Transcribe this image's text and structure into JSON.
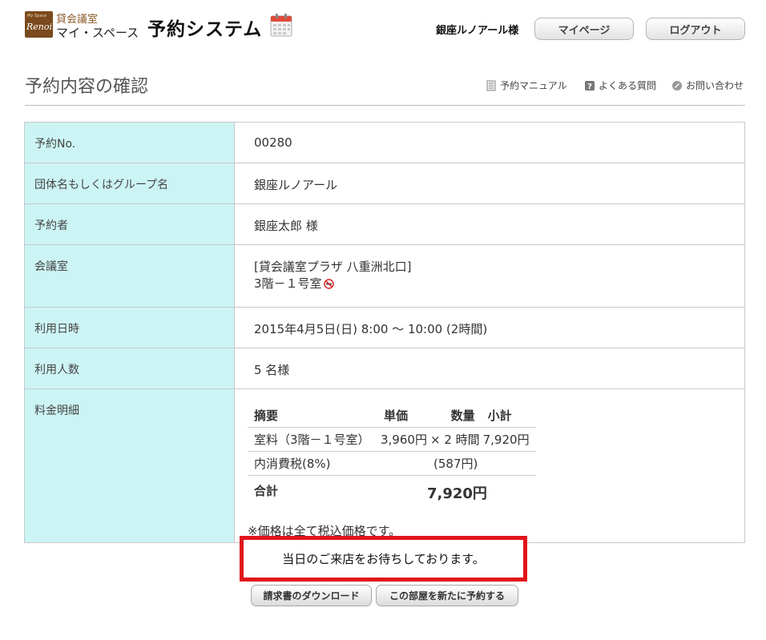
{
  "header": {
    "logo_text": "Renoir",
    "logo_top_text": "My Space",
    "brand_sub": "貸会議室",
    "brand_name": "マイ・スペース",
    "system_title": "予約システム",
    "user_name": "銀座ルノアール様",
    "mypage_label": "マイページ",
    "logout_label": "ログアウト"
  },
  "page": {
    "title": "予約内容の確認",
    "links": {
      "manual": "予約マニュアル",
      "faq": "よくある質問",
      "contact": "お問い合わせ"
    }
  },
  "reservation": {
    "no_label": "予約No.",
    "no_value": "00280",
    "group_label": "団体名もしくはグループ名",
    "group_value": "銀座ルノアール",
    "person_label": "予約者",
    "person_value": "銀座太郎 様",
    "room_label": "会議室",
    "room_line1": "[貸会議室プラザ 八重洲北口]",
    "room_line2": "3階－１号室",
    "datetime_label": "利用日時",
    "datetime_value": "2015年4月5日(日) 8:00 ～ 10:00 (2時間)",
    "people_label": "利用人数",
    "people_value": "5 名様",
    "fee_label": "料金明細"
  },
  "fee": {
    "headers": {
      "desc": "摘要",
      "unit": "単価",
      "qty": "数量",
      "subtotal": "小計"
    },
    "item": {
      "desc": "室料（3階－１号室）",
      "unit": "3,960円",
      "times": "×",
      "qty": "2 時間",
      "subtotal": "7,920円"
    },
    "tax": {
      "desc": "内消費税(8%)",
      "value": "(587円)"
    },
    "total": {
      "label": "合計",
      "value": "7,920円"
    },
    "note": "※価格は全て税込価格です。"
  },
  "notice": "当日のご来店をお待ちしております。",
  "buttons": {
    "invoice": "請求書のダウンロード",
    "rebook": "この部屋を新たに予約する"
  },
  "colors": {
    "label_bg": "#cdf4f4",
    "notice_border": "#e2141b",
    "logo_bg": "#7a4a1d"
  }
}
